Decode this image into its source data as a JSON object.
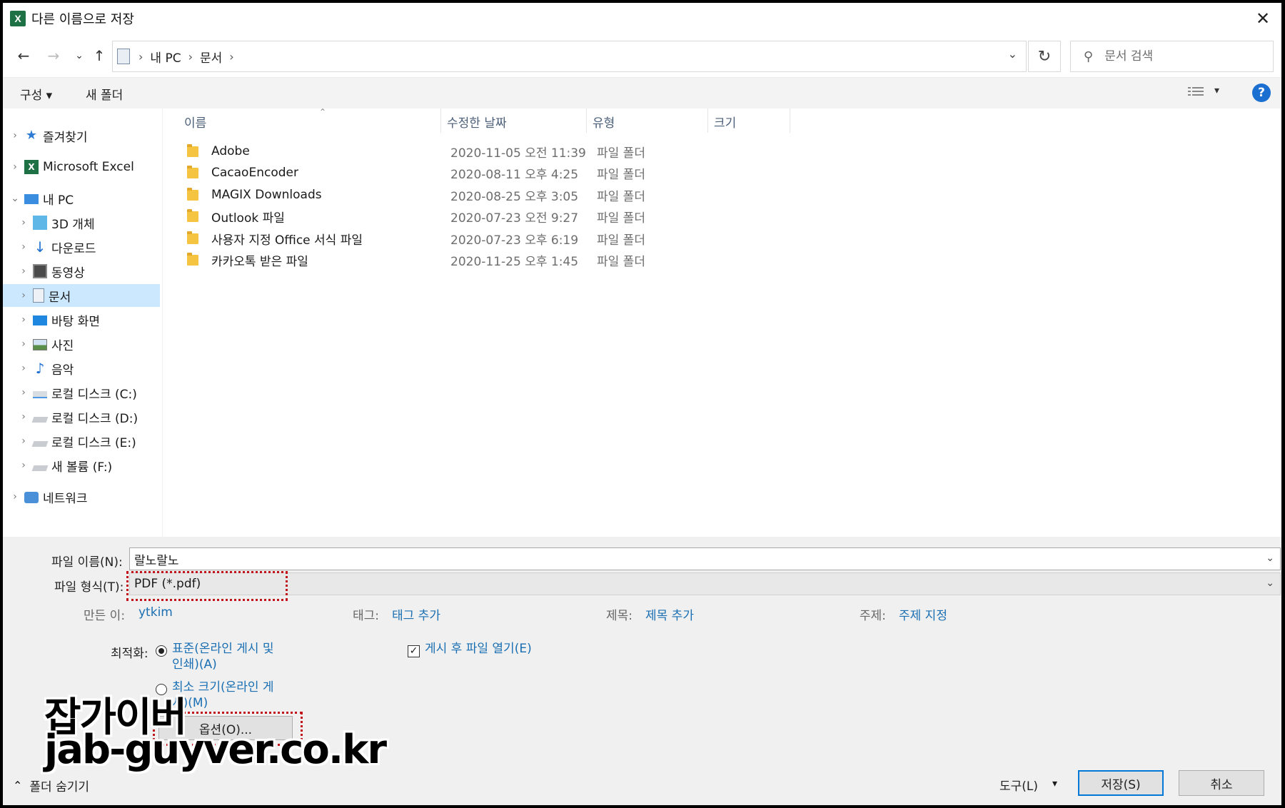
{
  "window": {
    "title": "다른 이름으로 저장",
    "app_icon": "X"
  },
  "nav": {
    "path": [
      "내 PC",
      "문서"
    ],
    "search_placeholder": "문서 검색"
  },
  "toolbar": {
    "organize": "구성 ▾",
    "new_folder": "새 폴더",
    "help": "?"
  },
  "tree": [
    {
      "label": "즐겨찾기",
      "icon": "star-icon"
    },
    {
      "label": "Microsoft Excel",
      "icon": "excel-icon"
    },
    {
      "label": "내 PC",
      "icon": "pc-icon"
    },
    {
      "label": "3D 개체",
      "icon": "cube-icon"
    },
    {
      "label": "다운로드",
      "icon": "download-icon"
    },
    {
      "label": "동영상",
      "icon": "video-icon"
    },
    {
      "label": "문서",
      "icon": "document-icon"
    },
    {
      "label": "바탕 화면",
      "icon": "desktop-icon"
    },
    {
      "label": "사진",
      "icon": "picture-icon"
    },
    {
      "label": "음악",
      "icon": "music-icon"
    },
    {
      "label": "로컬 디스크 (C:)",
      "icon": "drive-icon"
    },
    {
      "label": "로컬 디스크 (D:)",
      "icon": "drive-icon"
    },
    {
      "label": "로컬 디스크 (E:)",
      "icon": "drive-icon"
    },
    {
      "label": "새 볼륨 (F:)",
      "icon": "drive-icon"
    },
    {
      "label": "네트워크",
      "icon": "network-icon"
    }
  ],
  "columns": {
    "name": "이름",
    "modified": "수정한 날짜",
    "type": "유형",
    "size": "크기"
  },
  "files": [
    {
      "name": "Adobe",
      "modified": "2020-11-05 오전 11:39",
      "type": "파일 폴더"
    },
    {
      "name": "CacaoEncoder",
      "modified": "2020-08-11 오후 4:25",
      "type": "파일 폴더"
    },
    {
      "name": "MAGIX Downloads",
      "modified": "2020-08-25 오후 3:05",
      "type": "파일 폴더"
    },
    {
      "name": "Outlook 파일",
      "modified": "2020-07-23 오전 9:27",
      "type": "파일 폴더"
    },
    {
      "name": "사용자 지정 Office 서식 파일",
      "modified": "2020-07-23 오후 6:19",
      "type": "파일 폴더"
    },
    {
      "name": "카카오톡 받은 파일",
      "modified": "2020-11-25 오후 1:45",
      "type": "파일 폴더"
    }
  ],
  "save": {
    "filename_label": "파일 이름(N):",
    "filename_value": "랄노랄노",
    "filetype_label": "파일 형식(T):",
    "filetype_value": "PDF (*.pdf)",
    "author_label": "만든 이:",
    "author_value": "ytkim",
    "tags_label": "태그:",
    "tags_value": "태그 추가",
    "title_label": "제목:",
    "title_value": "제목 추가",
    "subject_label": "주제:",
    "subject_value": "주제 지정",
    "optimize_label": "최적화:",
    "opt_standard": "표준(온라인 게시 및\n인쇄)(A)",
    "opt_minimum": "최소 크기(온라인 게\n시)(M)",
    "open_after_publish": "게시 후 파일 열기(E)",
    "options_button": "옵션(O)...",
    "hide_folders": "폴더 숨기기",
    "tools": "도구(L)",
    "save_button": "저장(S)",
    "cancel_button": "취소"
  },
  "watermark": {
    "line1": "잡가이버",
    "line2": "jab-guyver.co.kr"
  }
}
